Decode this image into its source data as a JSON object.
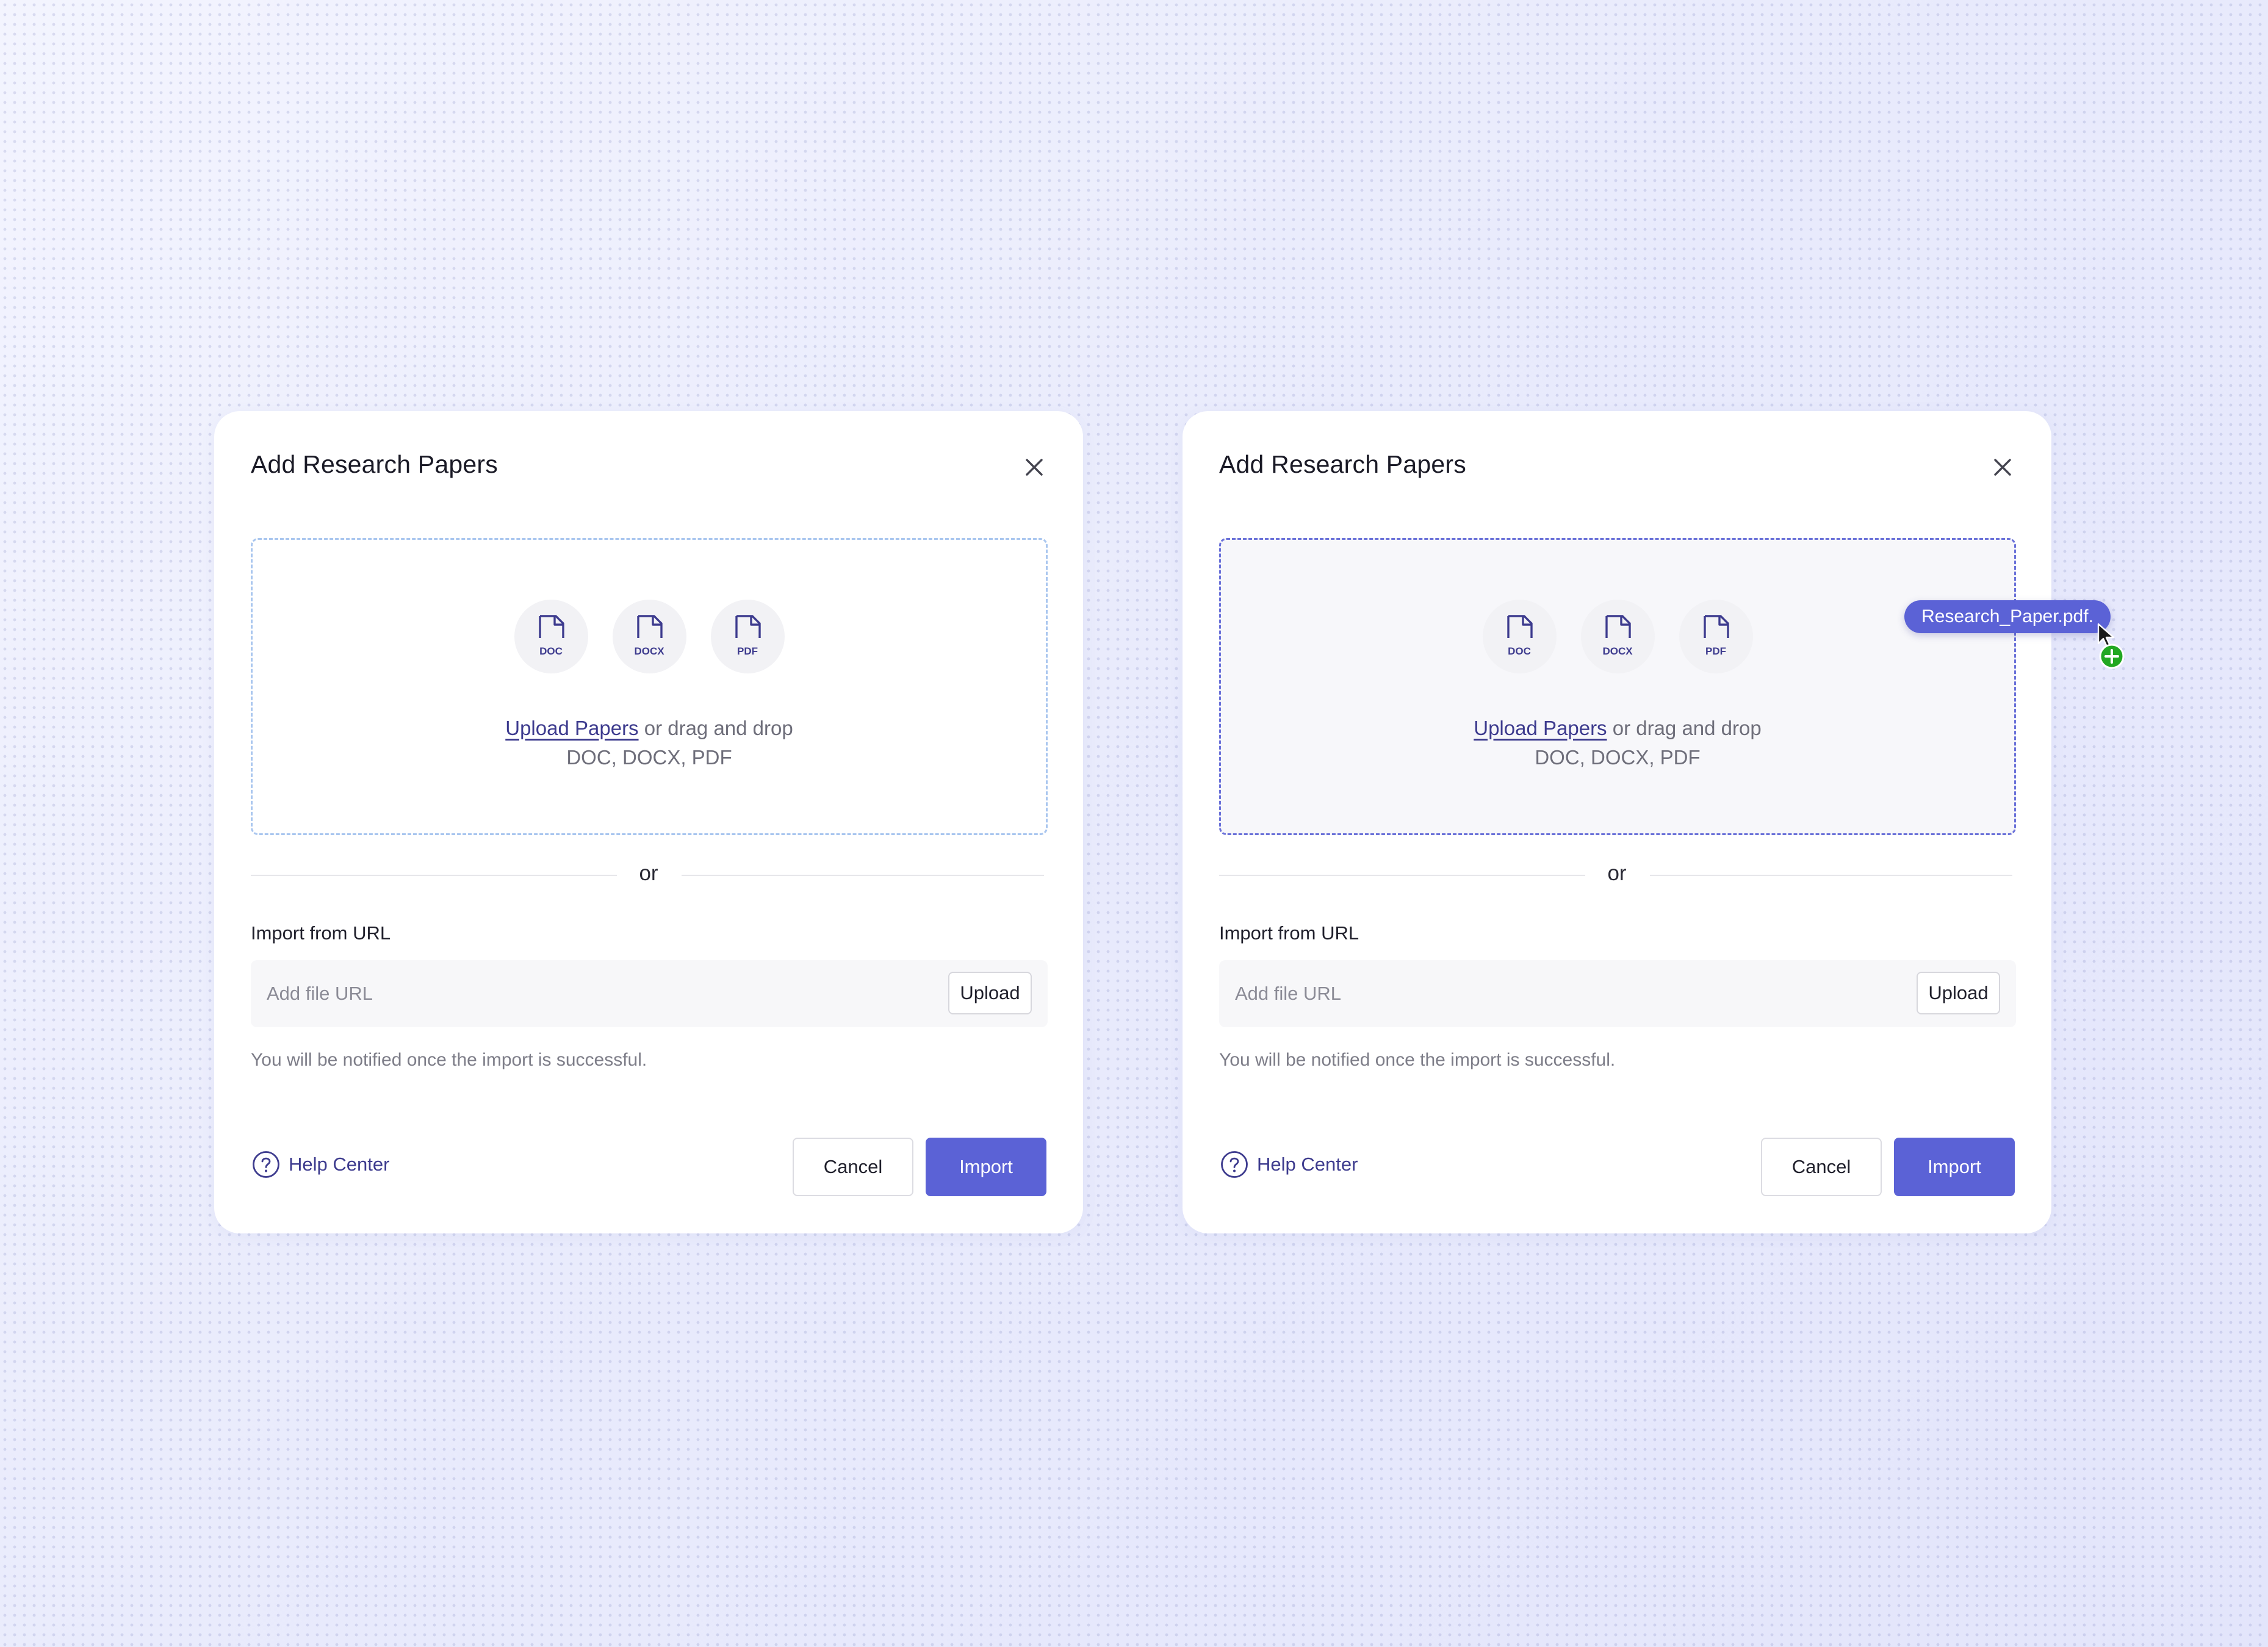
{
  "dialogs": [
    {
      "title": "Add Research Papers",
      "dropzone": {
        "file_types": [
          "DOC",
          "DOCX",
          "PDF"
        ],
        "upload_link": "Upload Papers",
        "drag_text": " or drag and drop",
        "formats": "DOC, DOCX, PDF"
      },
      "divider": "or",
      "url_label": "Import from URL",
      "url_placeholder": "Add file URL",
      "upload_button": "Upload",
      "note": "You will be notified once the import is successful.",
      "help": "Help Center",
      "cancel": "Cancel",
      "import": "Import"
    },
    {
      "title": "Add Research Papers",
      "dropzone": {
        "file_types": [
          "DOC",
          "DOCX",
          "PDF"
        ],
        "upload_link": "Upload Papers",
        "drag_text": " or drag and drop",
        "formats": "DOC, DOCX, PDF"
      },
      "divider": "or",
      "url_label": "Import from URL",
      "url_placeholder": "Add file URL",
      "upload_button": "Upload",
      "note": "You will be notified once the import is successful.",
      "help": "Help Center",
      "cancel": "Cancel",
      "import": "Import"
    }
  ],
  "drag": {
    "file_name": "Research_Paper.pdf.",
    "icons": [
      "pointer-cursor-icon",
      "add-plus-icon"
    ]
  },
  "colors": {
    "accent": "#5b62d6",
    "link": "#3d3b8e",
    "dropzone_border": "#a9c6ef",
    "dropzone_border_active": "#6b72d9",
    "add_badge": "#22a822"
  }
}
